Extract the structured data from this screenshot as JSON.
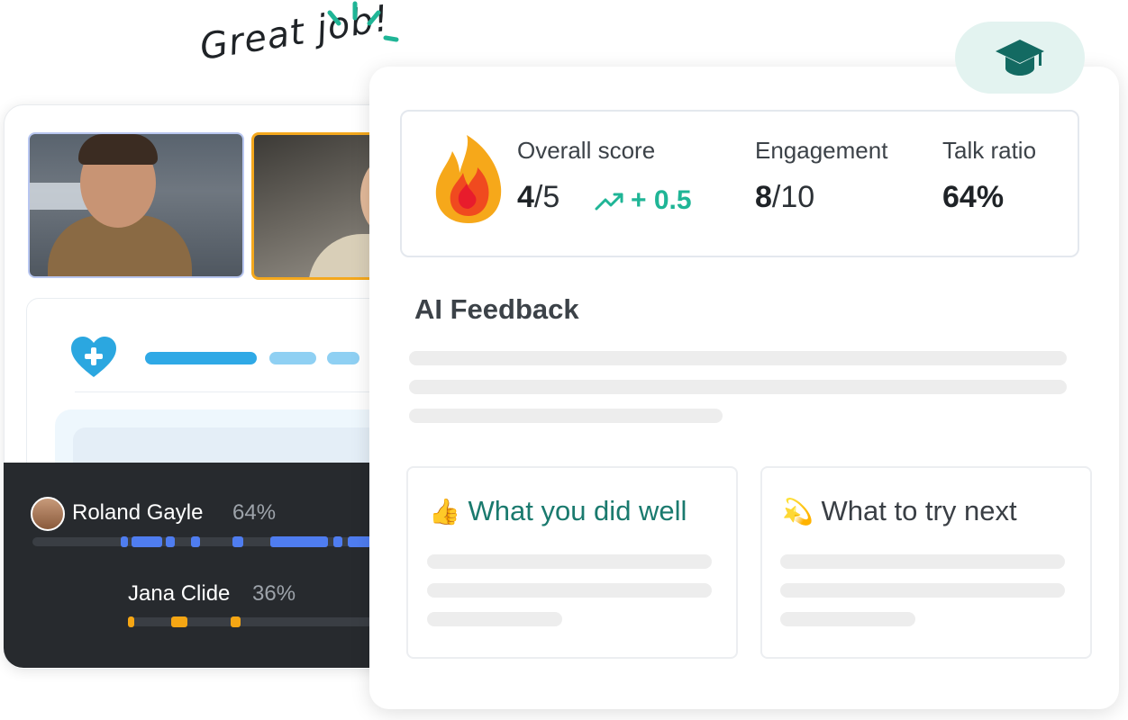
{
  "celebration": {
    "text": "Great job!"
  },
  "call": {
    "participants": [
      {
        "name": "Roland Gayle",
        "talk_share": "64%",
        "color": "#4f7df0"
      },
      {
        "name": "Jana Clide",
        "talk_share": "36%",
        "color": "#f5a614"
      }
    ]
  },
  "scorecard": {
    "overall": {
      "label": "Overall score",
      "value": "4",
      "max": "/5",
      "delta": "+ 0.5"
    },
    "engagement": {
      "label": "Engagement",
      "value": "8",
      "max": "/10"
    },
    "talk_ratio": {
      "label": "Talk ratio",
      "value": "64%"
    }
  },
  "feedback": {
    "title": "AI Feedback",
    "cards": [
      {
        "emoji": "👍",
        "title": "What you did well",
        "color": "#1a7a6e"
      },
      {
        "emoji": "💫",
        "title": "What to try next",
        "color": "#3a3f45"
      }
    ]
  },
  "colors": {
    "accent_teal": "#1fb596",
    "badge_bg": "#e3f3f0",
    "dark_panel": "#272a2e"
  },
  "icons": [
    "graduation-cap-icon",
    "flame-icon",
    "trend-up-icon",
    "heart-plus-icon",
    "sparkle-icon"
  ]
}
